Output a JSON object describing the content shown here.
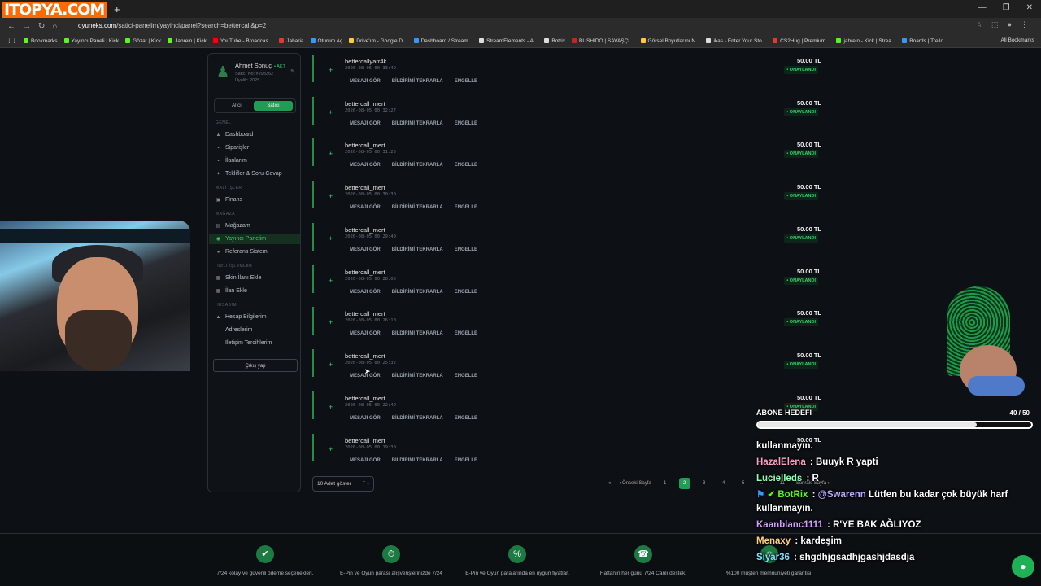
{
  "browser": {
    "logo_text": "ITOPYA.COM",
    "new_tab": "+",
    "url_prefix": "oyuneks.com",
    "url_rest": "/satici-panelim/yayinci/panel?search=bettercall&p=2",
    "bookmarks": [
      "Bookmarks",
      "Yayıncı Paneli | Kick",
      "Gözat | Kick",
      "Jahrein | Kick",
      "YouTube - Broadcas...",
      "Jaharia",
      "Oturum Aç",
      "Drive'ım - Google D...",
      "Dashboard / Stream...",
      "StreamElements - A...",
      "Botrix",
      "BUSHIDO | SAVAŞÇI...",
      "Görsel Boyutlarını N...",
      "ikas - Enter Your Sto...",
      "CS2Hug | Premium...",
      "jahrein - Kick | Strea...",
      "Boards | Trello"
    ],
    "all_bookmarks": "All Bookmarks"
  },
  "sidebar": {
    "user_name": "Ahmet Sonuç",
    "user_badge": "• AKT",
    "user_seller_no": "Satıcı No: #298362",
    "user_member_since": "Üyelik: 2025",
    "toggle_buyer": "Alıcı",
    "toggle_seller": "Satıcı",
    "sections": {
      "genel": "GENEL",
      "mali": "MALİ İŞLER",
      "magaza": "MAĞAZA",
      "hizli": "HIZLI İŞLEMLER",
      "hesabim": "HESABIM"
    },
    "items": {
      "dashboard": "Dashboard",
      "siparisler": "Siparişler",
      "ilanlarim": "İlanlarım",
      "teklifler": "Teklifler & Soru-Cevap",
      "finans": "Finans",
      "magazam": "Mağazam",
      "yayinci": "Yayıncı Panelim",
      "referans": "Referans Sistemi",
      "skin": "Skin İlanı Ekle",
      "ilan": "İlan Ekle",
      "hesap": "Hesap Bilgilerim",
      "adres": "Adreslerim",
      "iletisim": "İletişim Tercihlerim"
    },
    "logout": "Çıkış yap"
  },
  "list": {
    "actions": {
      "view": "MESAJI GÖR",
      "repeat": "BİLDİRİMİ TEKRARLA",
      "block": "ENGELLE"
    },
    "rows": [
      {
        "name": "bettercallyarr4k",
        "date": "2026-08-05 00:33:49",
        "price": "50.00 TL",
        "status": "• ONAYLANDI"
      },
      {
        "name": "bettercall_mert",
        "date": "2026-08-05 00:32:27",
        "price": "50.00 TL",
        "status": "• ONAYLANDI"
      },
      {
        "name": "bettercall_mert",
        "date": "2026-08-05 00:31:25",
        "price": "50.00 TL",
        "status": "• ONAYLANDI"
      },
      {
        "name": "bettercall_mert",
        "date": "2026-08-05 00:30:30",
        "price": "50.00 TL",
        "status": "• ONAYLANDI"
      },
      {
        "name": "bettercall_mert",
        "date": "2026-08-05 00:29:40",
        "price": "50.00 TL",
        "status": "• ONAYLANDI"
      },
      {
        "name": "bettercall_mert",
        "date": "2026-08-05 00:28:05",
        "price": "50.00 TL",
        "status": "• ONAYLANDI"
      },
      {
        "name": "bettercall_mert",
        "date": "2026-08-05 00:26:10",
        "price": "50.00 TL",
        "status": "• ONAYLANDI"
      },
      {
        "name": "bettercall_mert",
        "date": "2026-08-05 00:25:32",
        "price": "50.00 TL",
        "status": "• ONAYLANDI"
      },
      {
        "name": "bettercall_mert",
        "date": "2026-08-05 00:22:49",
        "price": "50.00 TL",
        "status": "• ONAYLANDI"
      },
      {
        "name": "bettercall_mert",
        "date": "2026-08-05 00:19:30",
        "price": "50.00 TL",
        "status": ""
      }
    ]
  },
  "pagination": {
    "per_page": "10 Adet göster",
    "first": "«",
    "prev": "‹ Önceki Sayfa",
    "pages": [
      "1",
      "2",
      "3",
      "4",
      "5",
      "…",
      "11"
    ],
    "current": "2",
    "next": "Sonraki Sayfa ›"
  },
  "footer": {
    "features": [
      {
        "icon": "shield-check-icon",
        "glyph": "✔",
        "text": "7/24 kolay ve güvenli ödeme seçenekleri."
      },
      {
        "icon": "stopwatch-icon",
        "glyph": "⏱",
        "text": "E-Pin ve Oyun parası alışverişlerinizde 7/24"
      },
      {
        "icon": "percent-icon",
        "glyph": "%",
        "text": "E-Pin ve Oyun paralarında en uygun fiyatlar."
      },
      {
        "icon": "headset-icon",
        "glyph": "☎",
        "text": "Haftanın her günü 7/24 Canlı destek."
      },
      {
        "icon": "smile-icon",
        "glyph": "☺",
        "text": "%100 müşteri memnuniyeti garantisi."
      }
    ]
  },
  "overlay": {
    "goal_title": "ABONE HEDEFİ",
    "goal_count": "40 / 50",
    "goal_fraction": 0.8,
    "chat": [
      {
        "user": "",
        "color": "#ffffff",
        "text": "kullanmayın."
      },
      {
        "user": "HazalElena",
        "color": "#ff9ec7",
        "text": "Buuyk R yapti"
      },
      {
        "user": "Lucielleds",
        "color": "#8fffb4",
        "text": "R"
      },
      {
        "user": "BotRix",
        "color": "#53fc18",
        "mention": "@Swarenn",
        "text": "Lütfen bu kadar çok büyük harf kullanmayın."
      },
      {
        "user": "Kaanblanc1111",
        "color": "#d39cff",
        "text": "R'YE BAK AĞLIYOZ"
      },
      {
        "user": "Menaxy",
        "color": "#ffd27a",
        "text": "kardeşim"
      },
      {
        "user": "Siyar36",
        "color": "#7fe0ff",
        "text": "shgdhjgsadhjgashjdasdja"
      }
    ]
  },
  "colors": {
    "accent": "#1f9d55",
    "status_ok": "#2fd36a",
    "bg": "#0d1014"
  }
}
